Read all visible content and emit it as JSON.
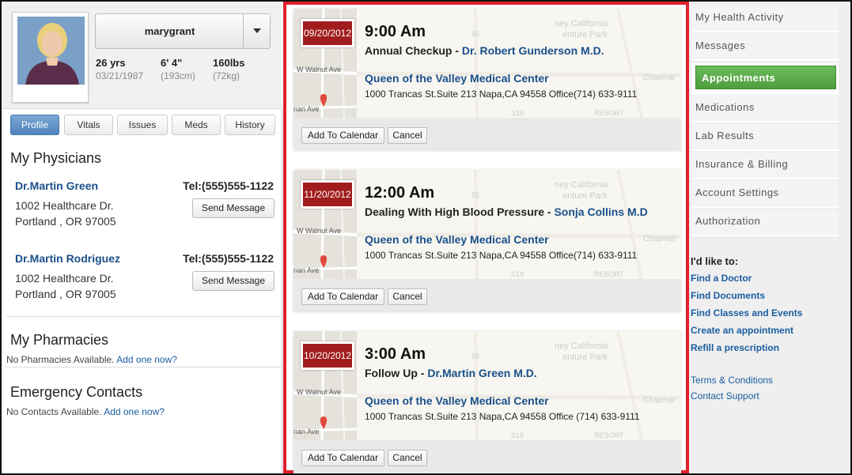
{
  "profile": {
    "username": "marygrant",
    "age": "26 yrs",
    "dob": "03/21/1987",
    "height": "6' 4\"",
    "height_metric": "(193cm)",
    "weight": "160lbs",
    "weight_metric": "(72kg)"
  },
  "tabs": [
    "Profile",
    "Vitals",
    "Issues",
    "Meds",
    "History"
  ],
  "physicians": {
    "title": "My Physicians",
    "send_label": "Send Message",
    "items": [
      {
        "name": "Dr.Martin Green",
        "tel": "Tel:(555)555-1122",
        "addr1": "1002 Healthcare Dr.",
        "addr2": "Portland , OR 97005"
      },
      {
        "name": "Dr.Martin Rodriguez",
        "tel": "Tel:(555)555-1122",
        "addr1": "1002 Healthcare Dr.",
        "addr2": "Portland , OR 97005"
      }
    ]
  },
  "pharmacies": {
    "title": "My Pharmacies",
    "none": "No Pharmacies Available.",
    "add": "Add one now?"
  },
  "emergency": {
    "title": "Emergency Contacts",
    "none": "No Contacts Available.",
    "add": "Add one now?"
  },
  "appointments": {
    "add_calendar": "Add To Calendar",
    "cancel": "Cancel",
    "items": [
      {
        "date": "09/20/2012",
        "time": "9:00 Am",
        "title": "Annual Checkup - ",
        "doctor": "Dr. Robert Gunderson M.D.",
        "clinic": "Queen of the Valley Medical Center",
        "address": "1000 Trancas St.Suite 213 Napa,CA 94558 Office(714) 633-9111"
      },
      {
        "date": "11/20/2012",
        "time": "12:00 Am",
        "title": "Dealing With High Blood Pressure - ",
        "doctor": "Sonja Collins M.D",
        "clinic": "Queen of the Valley Medical Center",
        "address": "1000 Trancas St.Suite 213 Napa,CA 94558 Office(714) 633-9111"
      },
      {
        "date": "10/20/2012",
        "time": "3:00 Am",
        "title": "Follow Up - ",
        "doctor": "Dr.Martin Green M.D.",
        "clinic": "Queen of the Valley Medical Center",
        "address": "1000 Trancas St.Suite 213 Napa,CA 94558 Office (714) 633-9111"
      }
    ],
    "map_labels": {
      "street": "W Walnut Ave",
      "ave": "nan Ave",
      "park1": "ney California",
      "park2": "enture Park",
      "road": "Chapmar",
      "resort": "RESORT",
      "route55": "55",
      "route518": "S18"
    }
  },
  "nav": {
    "items": [
      "My Health Activity",
      "Messages",
      "Appointments",
      "Medications",
      "Lab Results",
      "Insurance & Billing",
      "Account Settings",
      "Authorization"
    ],
    "active": "Appointments"
  },
  "like": {
    "title": "I'd like to:",
    "links": [
      "Find a Doctor",
      "Find Documents",
      "Find Classes and Events",
      "Create an appointment",
      "Refill a prescription"
    ]
  },
  "footer": {
    "terms": "Terms & Conditions",
    "support": "Contact Support"
  }
}
